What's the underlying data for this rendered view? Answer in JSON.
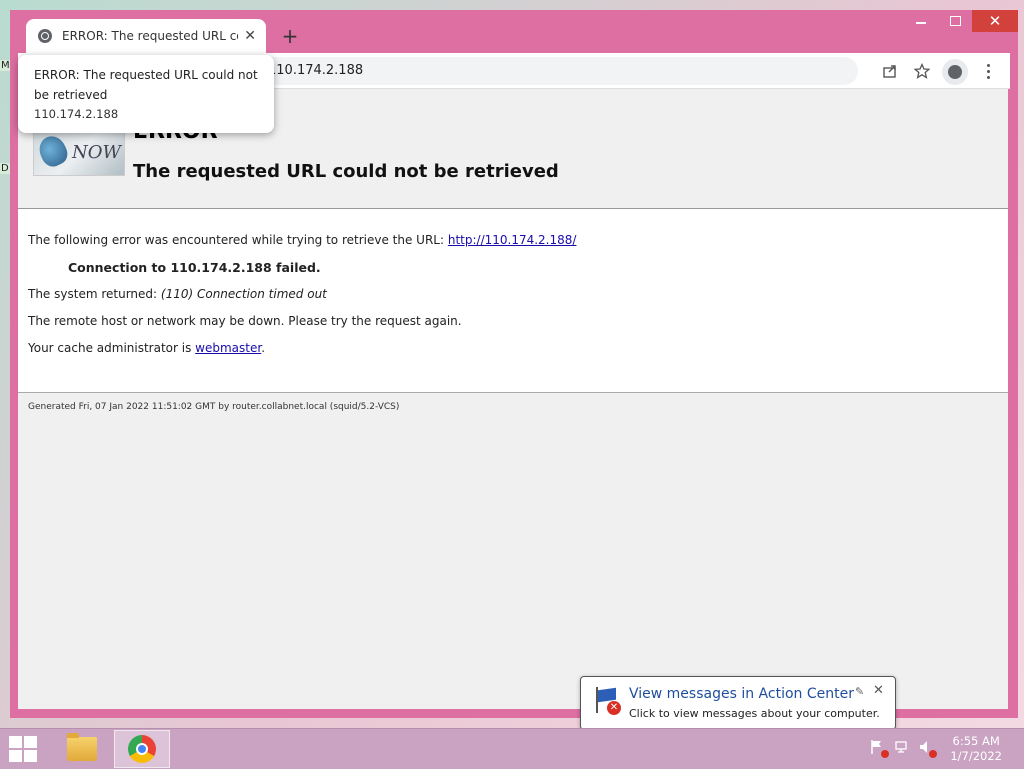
{
  "desktop": {
    "edge_labels": [
      "M",
      "D"
    ]
  },
  "window": {
    "controls": {
      "minimize": "—",
      "maximize": "□",
      "close": "✕"
    }
  },
  "tab": {
    "title": "ERROR: The requested URL could not be retrieved",
    "close": "✕",
    "new_tab": "+"
  },
  "toolbar": {
    "address": "110.174.2.188",
    "icons": {
      "share": "share-icon",
      "bookmark": "star-icon",
      "profile": "profile-icon",
      "menu": "kebab-menu-icon"
    }
  },
  "tooltip": {
    "title": "ERROR: The requested URL could not be retrieved",
    "url": "110.174.2.188"
  },
  "page": {
    "logo_text": "NOW",
    "heading": "ERROR",
    "subheading": "The requested URL could not be retrieved",
    "intro_prefix": "The following error was encountered while trying to retrieve the URL: ",
    "intro_link": "http://110.174.2.188/",
    "failure": "Connection to 110.174.2.188 failed.",
    "system_prefix": "The system returned: ",
    "system_msg": "(110) Connection timed out",
    "remote_msg": "The remote host or network may be down. Please try the request again.",
    "admin_prefix": "Your cache administrator is ",
    "admin_link": "webmaster",
    "admin_suffix": ".",
    "generated": "Generated Fri, 07 Jan 2022 11:51:02 GMT by router.collabnet.local (squid/5.2-VCS)"
  },
  "notification": {
    "title": "View messages in Action Center",
    "subtitle": "Click to view messages about your computer.",
    "close": "✕",
    "pin": "✎"
  },
  "taskbar": {
    "time": "6:55 AM",
    "date": "1/7/2022"
  }
}
